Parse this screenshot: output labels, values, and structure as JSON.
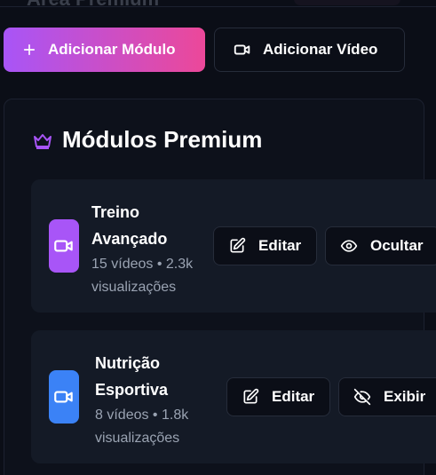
{
  "header": {
    "title": "Área Premium",
    "add_module_label": "Adicionar Módulo",
    "add_video_label": "Adicionar Vídeo"
  },
  "section": {
    "title": "Módulos Premium",
    "icon": "crown-icon"
  },
  "modules": [
    {
      "name_line1": "Treino",
      "name_line2": "Avançado",
      "stats_line1": "15 vídeos • 2.3k",
      "stats_line2": "visualizações",
      "icon": "video-icon",
      "icon_color": "#a855f7",
      "edit_label": "Editar",
      "toggle_label": "Ocultar",
      "toggle_icon": "eye-icon"
    },
    {
      "name_line1": "Nutrição",
      "name_line2": "Esportiva",
      "stats_line1": "8 vídeos • 1.8k",
      "stats_line2": "visualizações",
      "icon": "video-icon",
      "icon_color": "#3b82f6",
      "edit_label": "Editar",
      "toggle_label": "Exibir",
      "toggle_icon": "eye-off-icon"
    }
  ],
  "colors": {
    "background": "#0b0e17",
    "gradient_start": "#a855f7",
    "gradient_end": "#ec4899",
    "card": "#141a26",
    "muted_text": "#9aa3b2"
  }
}
